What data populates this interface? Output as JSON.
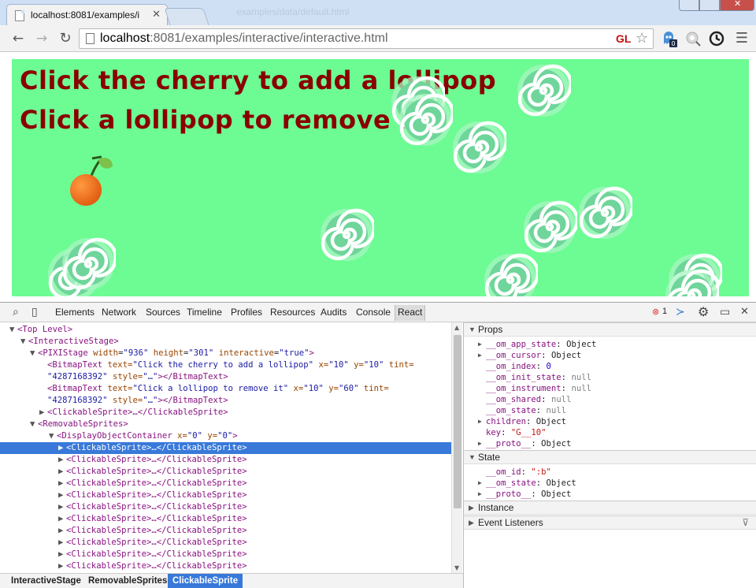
{
  "browser": {
    "tab_title": "localhost:8081/examples/i",
    "ghost_tab_title": "examples/data/default.html",
    "url_host": "localhost",
    "url_rest": ":8081/examples/interactive/interactive.html",
    "gl_badge": "GL",
    "extension_badge": "0"
  },
  "stage": {
    "line1": "Click the cherry to add a lollipop",
    "line2": "Click a lollipop to remove it",
    "background": "#6cfc93",
    "text_color": "#8a0000"
  },
  "devtools": {
    "tabs": [
      "Elements",
      "Network",
      "Sources",
      "Timeline",
      "Profiles",
      "Resources",
      "Audits",
      "Console",
      "React"
    ],
    "active_tab": "React",
    "error_count": "1",
    "tree": {
      "top_level": "<Top Level>",
      "interactive_stage": "<InteractiveStage>",
      "pixi_stage_tag": "<PIXIStage",
      "pixi_attrs": [
        {
          "name": "width",
          "value": "\"936\""
        },
        {
          "name": "height",
          "value": "\"301\""
        },
        {
          "name": "interactive",
          "value": "\"true\""
        }
      ],
      "bitmap1_a": "<BitmapText ",
      "bitmap1_text_attr": "text=",
      "bitmap1_text_val": "\"Click the cherry to add a lollipop\"",
      "bitmap1_x": "x=",
      "bitmap1_x_val": "\"10\"",
      "bitmap1_y": "y=",
      "bitmap1_y_val": "\"10\"",
      "bitmap1_tint": "tint=",
      "bitmap_tint_val": "\"4287168392\"",
      "bitmap_style": "style=",
      "bitmap_style_val": "\"…\"",
      "bitmap_close": "></BitmapText>",
      "bitmap2_text_val": "\"Click a lollipop to remove it\"",
      "bitmap2_y_val": "\"60\"",
      "clickable_collapsed": "<ClickableSprite>…</ClickableSprite>",
      "removable": "<RemovableSprites>",
      "doc_tag": "<DisplayObjectContainer",
      "doc_x": "x=",
      "doc_x_val": "\"0\"",
      "doc_y": "y=",
      "doc_y_val": "\"0\"",
      "doc_close": ">",
      "child_rows": [
        "<ClickableSprite>…</ClickableSprite>",
        "<ClickableSprite>…</ClickableSprite>",
        "<ClickableSprite>…</ClickableSprite>",
        "<ClickableSprite>…</ClickableSprite>",
        "<ClickableSprite>…</ClickableSprite>",
        "<ClickableSprite>…</ClickableSprite>",
        "<ClickableSprite>…</ClickableSprite>",
        "<ClickableSprite>…</ClickableSprite>",
        "<ClickableSprite>…</ClickableSprite>",
        "<ClickableSprite>…</ClickableSprite>",
        "<ClickableSprite>…</ClickableSprite>",
        "<ClickableSprite>…</ClickableSprite>"
      ]
    },
    "breadcrumbs": [
      "InteractiveStage",
      "RemovableSprites",
      "ClickableSprite"
    ],
    "props": {
      "title": "Props",
      "rows": [
        {
          "key": "__om_app_state",
          "value": "Object",
          "kind": "obj",
          "expandable": true
        },
        {
          "key": "__om_cursor",
          "value": "Object",
          "kind": "obj",
          "expandable": true
        },
        {
          "key": "__om_index",
          "value": "0",
          "kind": "num",
          "expandable": false
        },
        {
          "key": "__om_init_state",
          "value": "null",
          "kind": "nul",
          "expandable": false
        },
        {
          "key": "__om_instrument",
          "value": "null",
          "kind": "nul",
          "expandable": false
        },
        {
          "key": "__om_shared",
          "value": "null",
          "kind": "nul",
          "expandable": false
        },
        {
          "key": "__om_state",
          "value": "null",
          "kind": "nul",
          "expandable": false
        },
        {
          "key": "children",
          "value": "Object",
          "kind": "obj",
          "expandable": true
        },
        {
          "key": "key",
          "value": "\"G__10\"",
          "kind": "str",
          "expandable": false
        },
        {
          "key": "__proto__",
          "value": "Object",
          "kind": "obj",
          "expandable": true
        }
      ]
    },
    "state": {
      "title": "State",
      "rows": [
        {
          "key": "__om_id",
          "value": "\":b\"",
          "kind": "str",
          "expandable": false
        },
        {
          "key": "__om_state",
          "value": "Object",
          "kind": "obj",
          "expandable": true
        },
        {
          "key": "__proto__",
          "value": "Object",
          "kind": "obj",
          "expandable": true
        }
      ]
    },
    "instance_title": "Instance",
    "listeners_title": "Event Listeners"
  }
}
